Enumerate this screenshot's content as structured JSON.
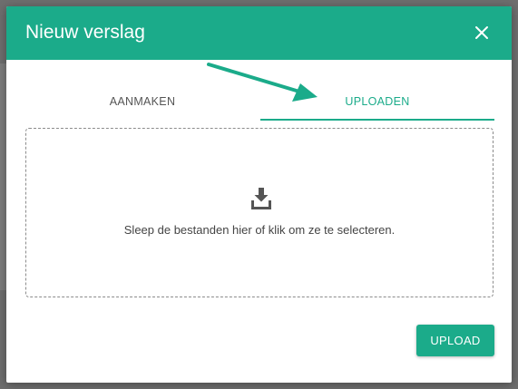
{
  "dialog": {
    "title": "Nieuw verslag",
    "close_icon": "close-icon"
  },
  "tabs": [
    {
      "label": "AANMAKEN",
      "active": false
    },
    {
      "label": "UPLOADEN",
      "active": true
    }
  ],
  "dropzone": {
    "icon": "download-tray-icon",
    "hint": "Sleep de bestanden hier of klik om ze te selecteren."
  },
  "actions": {
    "upload_label": "UPLOAD"
  },
  "colors": {
    "accent": "#1bab8a",
    "overlay": "#6e6e6e"
  }
}
